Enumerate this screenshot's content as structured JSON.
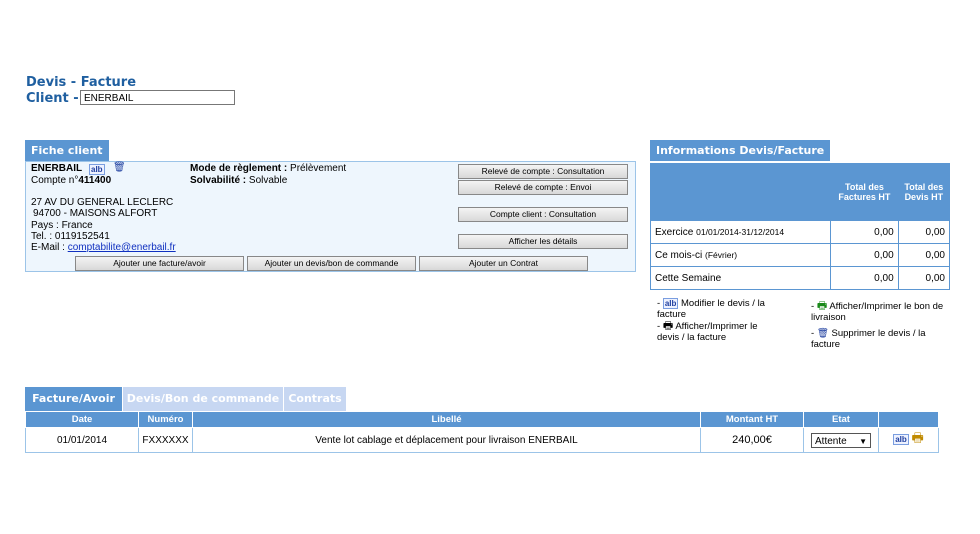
{
  "header": {
    "title": "Devis - Facture",
    "client_label": "Client -",
    "client_value": "ENERBAIL"
  },
  "fiche": {
    "tab_label": "Fiche client",
    "name": "ENERBAIL",
    "compte_prefix": "Compte n°",
    "compte_number": "411400",
    "address1": "27 AV DU GENERAL LECLERC",
    "address2": "94700 - MAISONS ALFORT",
    "pays": "Pays : France",
    "tel": "Tel. : 0119152541",
    "email_label": "E-Mail :",
    "email": "comptabilite@enerbail.fr",
    "mode_label": "Mode de règlement :",
    "mode_value": "Prélèvement",
    "solv_label": "Solvabilité :",
    "solv_value": "Solvable",
    "buttons": {
      "releve_consult": "Relevé de compte : Consultation",
      "releve_envoi": "Relevé de compte : Envoi",
      "compte_consult": "Compte client : Consultation",
      "details": "Afficher les détails",
      "add_facture": "Ajouter une facture/avoir",
      "add_devis": "Ajouter un devis/bon de commande",
      "add_contrat": "Ajouter un Contrat"
    }
  },
  "info": {
    "tab_label": "Informations Devis/Facture",
    "col_factures": "Total des Factures HT",
    "col_devis": "Total des Devis HT",
    "rows": [
      {
        "label": "Exercice",
        "sub": "01/01/2014-31/12/2014",
        "factures": "0,00",
        "devis": "0,00"
      },
      {
        "label": "Ce mois-ci",
        "sub": "(Février)",
        "factures": "0,00",
        "devis": "0,00"
      },
      {
        "label": "Cette Semaine",
        "sub": "",
        "factures": "0,00",
        "devis": "0,00"
      }
    ]
  },
  "legend": {
    "modify": "Modifier le devis / la facture",
    "print_devis": "Afficher/Imprimer le devis / la facture",
    "print_bon": "Afficher/Imprimer le bon de livraison",
    "delete": "Supprimer le devis / la facture"
  },
  "tabs": [
    "Facture/Avoir",
    "Devis/Bon de commande",
    "Contrats"
  ],
  "table": {
    "headers": [
      "Date",
      "Numéro",
      "Libellé",
      "Montant HT",
      "Etat",
      ""
    ],
    "rows": [
      {
        "date": "01/01/2014",
        "numero": "FXXXXXX",
        "libelle": "Vente lot cablage et déplacement pour livraison ENERBAIL",
        "montant": "240,00€",
        "etat": "Attente"
      }
    ]
  },
  "colors": {
    "accent": "#5b96d2",
    "title": "#1f5fa0",
    "inactive_tab": "#c7d7f2"
  }
}
